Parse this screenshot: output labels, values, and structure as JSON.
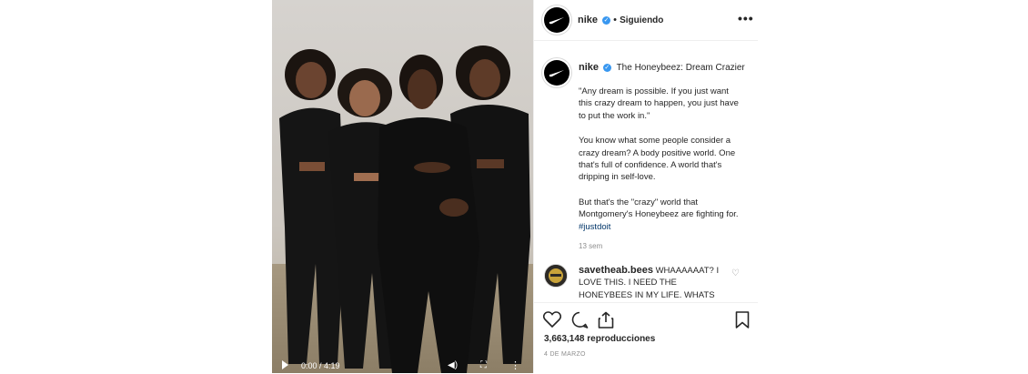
{
  "header": {
    "username": "nike",
    "separator": "•",
    "following_label": "Siguiendo",
    "more_label": "•••"
  },
  "caption": {
    "username": "nike",
    "title": "The Honeybeez: Dream Crazier",
    "paragraphs": [
      "\"Any dream is possible. If you just want this crazy dream to happen, you just have to put the work in.\"",
      "You know what some people consider a crazy dream? A body positive world. One that's full of confidence. A world that's dripping in self-love.",
      "But that's the \"crazy\" world that Montgomery's Honeybeez are fighting for."
    ],
    "hashtag": "#justdoit",
    "time_ago": "13 sem"
  },
  "comment": {
    "username": "savetheab.bees",
    "text": "WHAAAAAAT? I LOVE THIS. I NEED THE HONEYBEES IN MY LIFE. WHATS"
  },
  "actions": {
    "views_count": "3,663,148",
    "views_label": "reproducciones",
    "date": "4 DE MARZO"
  },
  "video": {
    "time": "0:00 / 4:19"
  },
  "colors": {
    "verified": "#3897f0",
    "hashtag": "#003569",
    "muted": "#8e8e8e",
    "border": "#efefef"
  },
  "icons": [
    "nike-swoosh-icon",
    "verified-icon",
    "more-icon",
    "heart-icon",
    "comment-icon",
    "share-icon",
    "bookmark-icon",
    "play-icon",
    "volume-icon",
    "fullscreen-icon"
  ]
}
